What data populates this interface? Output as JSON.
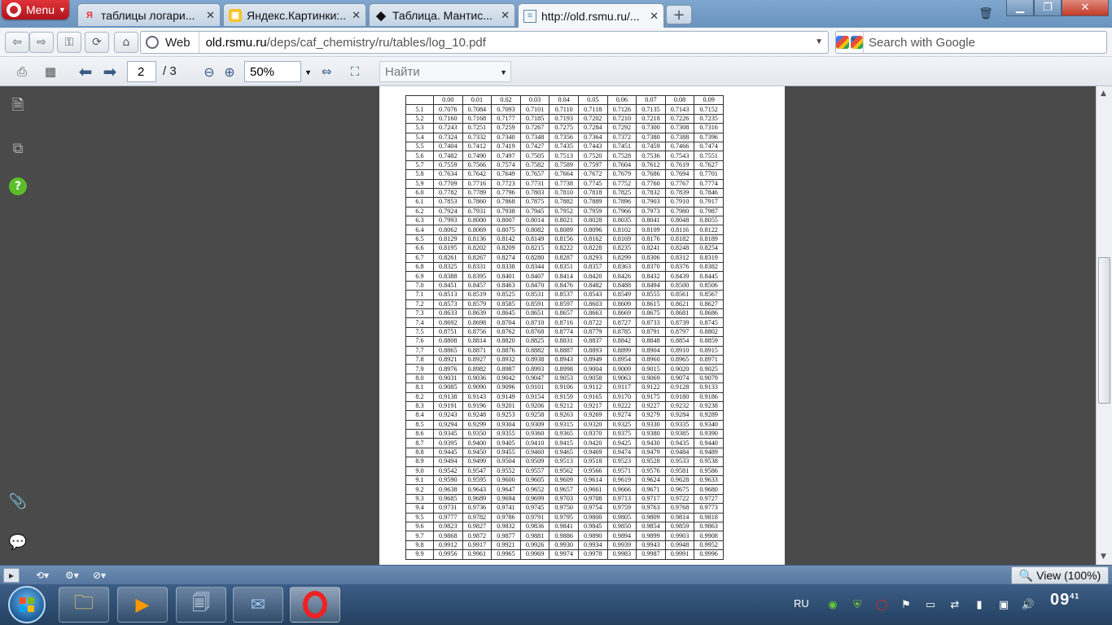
{
  "browser": {
    "menu_label": "Menu",
    "tabs": [
      {
        "title": "таблицы логари..."
      },
      {
        "title": "Яндекс.Картинки:..."
      },
      {
        "title": "Таблица. Мантис..."
      },
      {
        "title": "http://old.rsmu.ru/..."
      }
    ],
    "address": {
      "badge": "Web",
      "domain": "old.rsmu.ru",
      "path": "/deps/caf_chemistry/ru/tables/log_10.pdf"
    },
    "search_placeholder": "Search with Google"
  },
  "pdf_toolbar": {
    "current_page": "2",
    "total_pages": "/ 3",
    "zoom": "50%",
    "find_placeholder": "Найти"
  },
  "statusbar": {
    "view_label": "View (100%)"
  },
  "taskbar": {
    "language": "RU",
    "clock": "09",
    "clock_minutes": "41"
  },
  "table": {
    "headers": [
      "",
      "0.00",
      "0.01",
      "0.02",
      "0.03",
      "0.04",
      "0.05",
      "0.06",
      "0.07",
      "0.08",
      "0.09"
    ],
    "rows": [
      [
        "5.1",
        "0.7076",
        "0.7084",
        "0.7093",
        "0.7101",
        "0.7110",
        "0.7118",
        "0.7126",
        "0.7135",
        "0.7143",
        "0.7152"
      ],
      [
        "5.2",
        "0.7160",
        "0.7168",
        "0.7177",
        "0.7185",
        "0.7193",
        "0.7202",
        "0.7210",
        "0.7218",
        "0.7226",
        "0.7235"
      ],
      [
        "5.3",
        "0.7243",
        "0.7251",
        "0.7259",
        "0.7267",
        "0.7275",
        "0.7284",
        "0.7292",
        "0.7300",
        "0.7308",
        "0.7316"
      ],
      [
        "5.4",
        "0.7324",
        "0.7332",
        "0.7340",
        "0.7348",
        "0.7356",
        "0.7364",
        "0.7372",
        "0.7380",
        "0.7388",
        "0.7396"
      ],
      [
        "5.5",
        "0.7404",
        "0.7412",
        "0.7419",
        "0.7427",
        "0.7435",
        "0.7443",
        "0.7451",
        "0.7459",
        "0.7466",
        "0.7474"
      ],
      [
        "5.6",
        "0.7482",
        "0.7490",
        "0.7497",
        "0.7505",
        "0.7513",
        "0.7520",
        "0.7528",
        "0.7536",
        "0.7543",
        "0.7551"
      ],
      [
        "5.7",
        "0.7559",
        "0.7566",
        "0.7574",
        "0.7582",
        "0.7589",
        "0.7597",
        "0.7604",
        "0.7612",
        "0.7619",
        "0.7627"
      ],
      [
        "5.8",
        "0.7634",
        "0.7642",
        "0.7649",
        "0.7657",
        "0.7664",
        "0.7672",
        "0.7679",
        "0.7686",
        "0.7694",
        "0.7701"
      ],
      [
        "5.9",
        "0.7709",
        "0.7716",
        "0.7723",
        "0.7731",
        "0.7738",
        "0.7745",
        "0.7752",
        "0.7760",
        "0.7767",
        "0.7774"
      ],
      [
        "6.0",
        "0.7782",
        "0.7789",
        "0.7796",
        "0.7803",
        "0.7810",
        "0.7818",
        "0.7825",
        "0.7832",
        "0.7839",
        "0.7846"
      ],
      [
        "6.1",
        "0.7853",
        "0.7860",
        "0.7868",
        "0.7875",
        "0.7882",
        "0.7889",
        "0.7896",
        "0.7903",
        "0.7910",
        "0.7917"
      ],
      [
        "6.2",
        "0.7924",
        "0.7931",
        "0.7938",
        "0.7945",
        "0.7952",
        "0.7959",
        "0.7966",
        "0.7973",
        "0.7980",
        "0.7987"
      ],
      [
        "6.3",
        "0.7993",
        "0.8000",
        "0.8007",
        "0.8014",
        "0.8021",
        "0.8028",
        "0.8035",
        "0.8041",
        "0.8048",
        "0.8055"
      ],
      [
        "6.4",
        "0.8062",
        "0.8069",
        "0.8075",
        "0.8082",
        "0.8089",
        "0.8096",
        "0.8102",
        "0.8109",
        "0.8116",
        "0.8122"
      ],
      [
        "6.5",
        "0.8129",
        "0.8136",
        "0.8142",
        "0.8149",
        "0.8156",
        "0.8162",
        "0.8169",
        "0.8176",
        "0.8182",
        "0.8189"
      ],
      [
        "6.6",
        "0.8195",
        "0.8202",
        "0.8209",
        "0.8215",
        "0.8222",
        "0.8228",
        "0.8235",
        "0.8241",
        "0.8248",
        "0.8254"
      ],
      [
        "6.7",
        "0.8261",
        "0.8267",
        "0.8274",
        "0.8280",
        "0.8287",
        "0.8293",
        "0.8299",
        "0.8306",
        "0.8312",
        "0.8319"
      ],
      [
        "6.8",
        "0.8325",
        "0.8331",
        "0.8338",
        "0.8344",
        "0.8351",
        "0.8357",
        "0.8363",
        "0.8370",
        "0.8376",
        "0.8382"
      ],
      [
        "6.9",
        "0.8388",
        "0.8395",
        "0.8401",
        "0.8407",
        "0.8414",
        "0.8420",
        "0.8426",
        "0.8432",
        "0.8439",
        "0.8445"
      ],
      [
        "7.0",
        "0.8451",
        "0.8457",
        "0.8463",
        "0.8470",
        "0.8476",
        "0.8482",
        "0.8488",
        "0.8494",
        "0.8500",
        "0.8506"
      ],
      [
        "7.1",
        "0.8513",
        "0.8519",
        "0.8525",
        "0.8531",
        "0.8537",
        "0.8543",
        "0.8549",
        "0.8555",
        "0.8561",
        "0.8567"
      ],
      [
        "7.2",
        "0.8573",
        "0.8579",
        "0.8585",
        "0.8591",
        "0.8597",
        "0.8603",
        "0.8609",
        "0.8615",
        "0.8621",
        "0.8627"
      ],
      [
        "7.3",
        "0.8633",
        "0.8639",
        "0.8645",
        "0.8651",
        "0.8657",
        "0.8663",
        "0.8669",
        "0.8675",
        "0.8681",
        "0.8686"
      ],
      [
        "7.4",
        "0.8692",
        "0.8698",
        "0.8704",
        "0.8710",
        "0.8716",
        "0.8722",
        "0.8727",
        "0.8733",
        "0.8739",
        "0.8745"
      ],
      [
        "7.5",
        "0.8751",
        "0.8756",
        "0.8762",
        "0.8768",
        "0.8774",
        "0.8779",
        "0.8785",
        "0.8791",
        "0.8797",
        "0.8802"
      ],
      [
        "7.6",
        "0.8808",
        "0.8814",
        "0.8820",
        "0.8825",
        "0.8831",
        "0.8837",
        "0.8842",
        "0.8848",
        "0.8854",
        "0.8859"
      ],
      [
        "7.7",
        "0.8865",
        "0.8871",
        "0.8876",
        "0.8882",
        "0.8887",
        "0.8893",
        "0.8899",
        "0.8904",
        "0.8910",
        "0.8915"
      ],
      [
        "7.8",
        "0.8921",
        "0.8927",
        "0.8932",
        "0.8938",
        "0.8943",
        "0.8949",
        "0.8954",
        "0.8960",
        "0.8965",
        "0.8971"
      ],
      [
        "7.9",
        "0.8976",
        "0.8982",
        "0.8987",
        "0.8993",
        "0.8998",
        "0.9004",
        "0.9009",
        "0.9015",
        "0.9020",
        "0.9025"
      ],
      [
        "8.0",
        "0.9031",
        "0.9036",
        "0.9042",
        "0.9047",
        "0.9053",
        "0.9058",
        "0.9063",
        "0.9069",
        "0.9074",
        "0.9079"
      ],
      [
        "8.1",
        "0.9085",
        "0.9090",
        "0.9096",
        "0.9101",
        "0.9106",
        "0.9112",
        "0.9117",
        "0.9122",
        "0.9128",
        "0.9133"
      ],
      [
        "8.2",
        "0.9138",
        "0.9143",
        "0.9149",
        "0.9154",
        "0.9159",
        "0.9165",
        "0.9170",
        "0.9175",
        "0.9180",
        "0.9186"
      ],
      [
        "8.3",
        "0.9191",
        "0.9196",
        "0.9201",
        "0.9206",
        "0.9212",
        "0.9217",
        "0.9222",
        "0.9227",
        "0.9232",
        "0.9238"
      ],
      [
        "8.4",
        "0.9243",
        "0.9248",
        "0.9253",
        "0.9258",
        "0.9263",
        "0.9269",
        "0.9274",
        "0.9279",
        "0.9284",
        "0.9289"
      ],
      [
        "8.5",
        "0.9294",
        "0.9299",
        "0.9304",
        "0.9309",
        "0.9315",
        "0.9320",
        "0.9325",
        "0.9330",
        "0.9335",
        "0.9340"
      ],
      [
        "8.6",
        "0.9345",
        "0.9350",
        "0.9355",
        "0.9360",
        "0.9365",
        "0.9370",
        "0.9375",
        "0.9380",
        "0.9385",
        "0.9390"
      ],
      [
        "8.7",
        "0.9395",
        "0.9400",
        "0.9405",
        "0.9410",
        "0.9415",
        "0.9420",
        "0.9425",
        "0.9430",
        "0.9435",
        "0.9440"
      ],
      [
        "8.8",
        "0.9445",
        "0.9450",
        "0.9455",
        "0.9460",
        "0.9465",
        "0.9469",
        "0.9474",
        "0.9479",
        "0.9484",
        "0.9489"
      ],
      [
        "8.9",
        "0.9494",
        "0.9499",
        "0.9504",
        "0.9509",
        "0.9513",
        "0.9518",
        "0.9523",
        "0.9528",
        "0.9533",
        "0.9538"
      ],
      [
        "9.0",
        "0.9542",
        "0.9547",
        "0.9552",
        "0.9557",
        "0.9562",
        "0.9566",
        "0.9571",
        "0.9576",
        "0.9581",
        "0.9586"
      ],
      [
        "9.1",
        "0.9590",
        "0.9595",
        "0.9600",
        "0.9605",
        "0.9609",
        "0.9614",
        "0.9619",
        "0.9624",
        "0.9628",
        "0.9633"
      ],
      [
        "9.2",
        "0.9638",
        "0.9643",
        "0.9647",
        "0.9652",
        "0.9657",
        "0.9661",
        "0.9666",
        "0.9671",
        "0.9675",
        "0.9680"
      ],
      [
        "9.3",
        "0.9685",
        "0.9689",
        "0.9694",
        "0.9699",
        "0.9703",
        "0.9708",
        "0.9713",
        "0.9717",
        "0.9722",
        "0.9727"
      ],
      [
        "9.4",
        "0.9731",
        "0.9736",
        "0.9741",
        "0.9745",
        "0.9750",
        "0.9754",
        "0.9759",
        "0.9763",
        "0.9768",
        "0.9773"
      ],
      [
        "9.5",
        "0.9777",
        "0.9782",
        "0.9786",
        "0.9791",
        "0.9795",
        "0.9800",
        "0.9805",
        "0.9809",
        "0.9814",
        "0.9818"
      ],
      [
        "9.6",
        "0.9823",
        "0.9827",
        "0.9832",
        "0.9836",
        "0.9841",
        "0.9845",
        "0.9850",
        "0.9854",
        "0.9859",
        "0.9863"
      ],
      [
        "9.7",
        "0.9868",
        "0.9872",
        "0.9877",
        "0.9881",
        "0.9886",
        "0.9890",
        "0.9894",
        "0.9899",
        "0.9903",
        "0.9908"
      ],
      [
        "9.8",
        "0.9912",
        "0.9917",
        "0.9921",
        "0.9926",
        "0.9930",
        "0.9934",
        "0.9939",
        "0.9943",
        "0.9948",
        "0.9952"
      ],
      [
        "9.9",
        "0.9956",
        "0.9961",
        "0.9965",
        "0.9969",
        "0.9974",
        "0.9978",
        "0.9983",
        "0.9987",
        "0.9991",
        "0.9996"
      ]
    ]
  }
}
